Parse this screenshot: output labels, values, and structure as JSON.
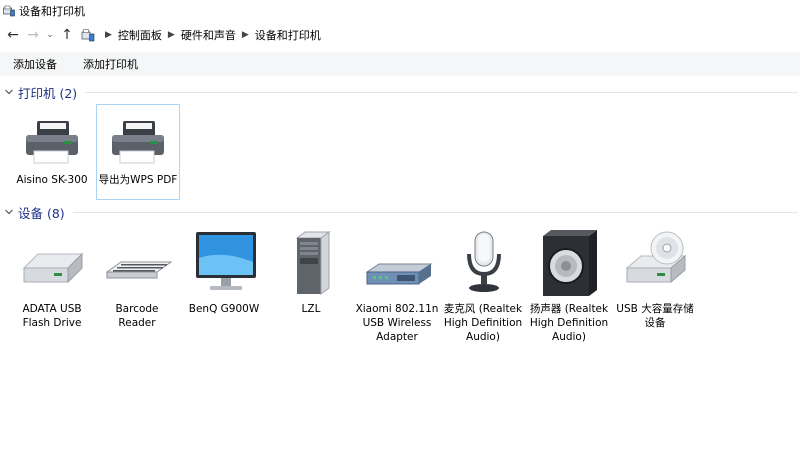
{
  "window": {
    "title": "设备和打印机"
  },
  "nav": {
    "back": "←",
    "forward": "→",
    "recent": "⌄",
    "up": "↑",
    "breadcrumbs": [
      "控制面板",
      "硬件和声音",
      "设备和打印机"
    ]
  },
  "toolbar": {
    "add_device": "添加设备",
    "add_printer": "添加打印机"
  },
  "groups": {
    "printers": {
      "title": "打印机 (2)",
      "items": [
        {
          "label": "Aisino SK-300",
          "icon": "printer-icon"
        },
        {
          "label": "导出为WPS PDF",
          "icon": "printer-icon",
          "selected": true
        }
      ]
    },
    "devices": {
      "title": "设备 (8)",
      "items": [
        {
          "label": "ADATA USB Flash Drive",
          "icon": "usb-drive-icon"
        },
        {
          "label": "Barcode Reader",
          "icon": "keyboard-icon"
        },
        {
          "label": "BenQ G900W",
          "icon": "monitor-icon"
        },
        {
          "label": "LZL",
          "icon": "computer-tower-icon"
        },
        {
          "label": "Xiaomi 802.11n USB Wireless Adapter",
          "icon": "network-adapter-icon"
        },
        {
          "label": "麦克风 (Realtek High Definition Audio)",
          "icon": "microphone-icon"
        },
        {
          "label": "扬声器 (Realtek High Definition Audio)",
          "icon": "speaker-icon"
        },
        {
          "label": "USB 大容量存储设备",
          "icon": "optical-drive-icon"
        }
      ]
    }
  }
}
